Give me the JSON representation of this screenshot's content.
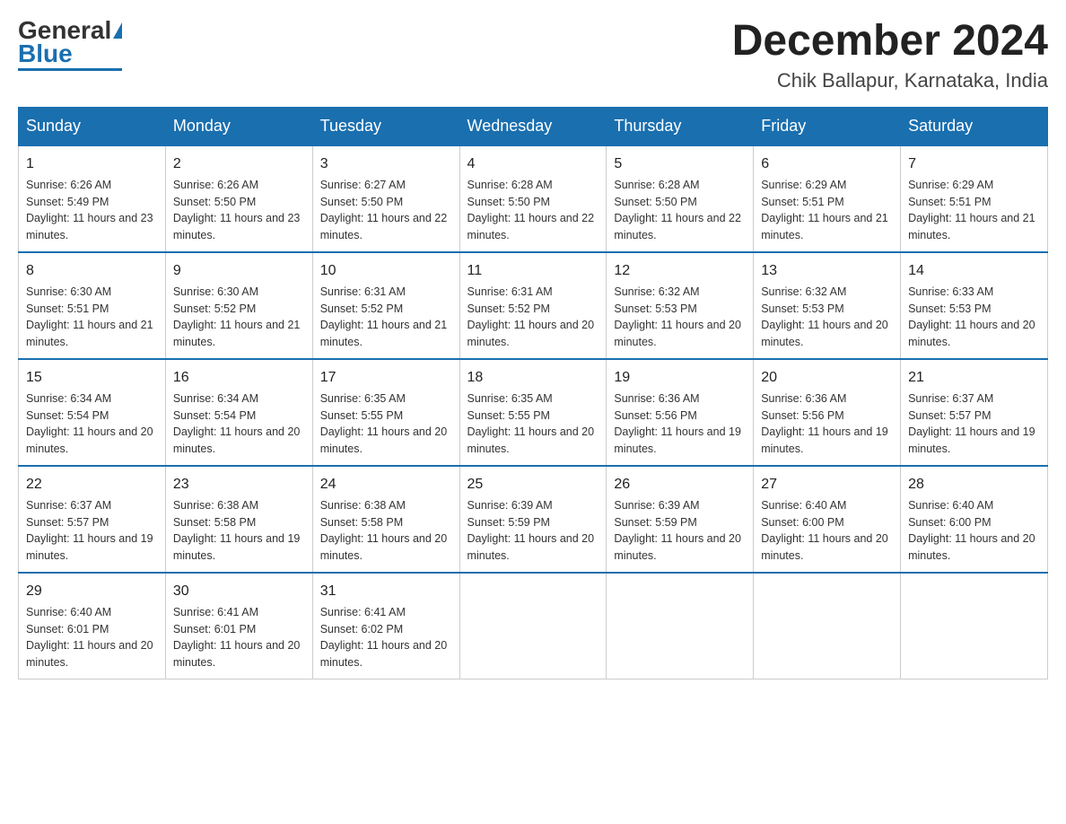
{
  "header": {
    "logo_general": "General",
    "logo_blue": "Blue",
    "month_title": "December 2024",
    "location": "Chik Ballapur, Karnataka, India"
  },
  "days_of_week": [
    "Sunday",
    "Monday",
    "Tuesday",
    "Wednesday",
    "Thursday",
    "Friday",
    "Saturday"
  ],
  "weeks": [
    [
      {
        "day": "1",
        "sunrise": "6:26 AM",
        "sunset": "5:49 PM",
        "daylight": "11 hours and 23 minutes."
      },
      {
        "day": "2",
        "sunrise": "6:26 AM",
        "sunset": "5:50 PM",
        "daylight": "11 hours and 23 minutes."
      },
      {
        "day": "3",
        "sunrise": "6:27 AM",
        "sunset": "5:50 PM",
        "daylight": "11 hours and 22 minutes."
      },
      {
        "day": "4",
        "sunrise": "6:28 AM",
        "sunset": "5:50 PM",
        "daylight": "11 hours and 22 minutes."
      },
      {
        "day": "5",
        "sunrise": "6:28 AM",
        "sunset": "5:50 PM",
        "daylight": "11 hours and 22 minutes."
      },
      {
        "day": "6",
        "sunrise": "6:29 AM",
        "sunset": "5:51 PM",
        "daylight": "11 hours and 21 minutes."
      },
      {
        "day": "7",
        "sunrise": "6:29 AM",
        "sunset": "5:51 PM",
        "daylight": "11 hours and 21 minutes."
      }
    ],
    [
      {
        "day": "8",
        "sunrise": "6:30 AM",
        "sunset": "5:51 PM",
        "daylight": "11 hours and 21 minutes."
      },
      {
        "day": "9",
        "sunrise": "6:30 AM",
        "sunset": "5:52 PM",
        "daylight": "11 hours and 21 minutes."
      },
      {
        "day": "10",
        "sunrise": "6:31 AM",
        "sunset": "5:52 PM",
        "daylight": "11 hours and 21 minutes."
      },
      {
        "day": "11",
        "sunrise": "6:31 AM",
        "sunset": "5:52 PM",
        "daylight": "11 hours and 20 minutes."
      },
      {
        "day": "12",
        "sunrise": "6:32 AM",
        "sunset": "5:53 PM",
        "daylight": "11 hours and 20 minutes."
      },
      {
        "day": "13",
        "sunrise": "6:32 AM",
        "sunset": "5:53 PM",
        "daylight": "11 hours and 20 minutes."
      },
      {
        "day": "14",
        "sunrise": "6:33 AM",
        "sunset": "5:53 PM",
        "daylight": "11 hours and 20 minutes."
      }
    ],
    [
      {
        "day": "15",
        "sunrise": "6:34 AM",
        "sunset": "5:54 PM",
        "daylight": "11 hours and 20 minutes."
      },
      {
        "day": "16",
        "sunrise": "6:34 AM",
        "sunset": "5:54 PM",
        "daylight": "11 hours and 20 minutes."
      },
      {
        "day": "17",
        "sunrise": "6:35 AM",
        "sunset": "5:55 PM",
        "daylight": "11 hours and 20 minutes."
      },
      {
        "day": "18",
        "sunrise": "6:35 AM",
        "sunset": "5:55 PM",
        "daylight": "11 hours and 20 minutes."
      },
      {
        "day": "19",
        "sunrise": "6:36 AM",
        "sunset": "5:56 PM",
        "daylight": "11 hours and 19 minutes."
      },
      {
        "day": "20",
        "sunrise": "6:36 AM",
        "sunset": "5:56 PM",
        "daylight": "11 hours and 19 minutes."
      },
      {
        "day": "21",
        "sunrise": "6:37 AM",
        "sunset": "5:57 PM",
        "daylight": "11 hours and 19 minutes."
      }
    ],
    [
      {
        "day": "22",
        "sunrise": "6:37 AM",
        "sunset": "5:57 PM",
        "daylight": "11 hours and 19 minutes."
      },
      {
        "day": "23",
        "sunrise": "6:38 AM",
        "sunset": "5:58 PM",
        "daylight": "11 hours and 19 minutes."
      },
      {
        "day": "24",
        "sunrise": "6:38 AM",
        "sunset": "5:58 PM",
        "daylight": "11 hours and 20 minutes."
      },
      {
        "day": "25",
        "sunrise": "6:39 AM",
        "sunset": "5:59 PM",
        "daylight": "11 hours and 20 minutes."
      },
      {
        "day": "26",
        "sunrise": "6:39 AM",
        "sunset": "5:59 PM",
        "daylight": "11 hours and 20 minutes."
      },
      {
        "day": "27",
        "sunrise": "6:40 AM",
        "sunset": "6:00 PM",
        "daylight": "11 hours and 20 minutes."
      },
      {
        "day": "28",
        "sunrise": "6:40 AM",
        "sunset": "6:00 PM",
        "daylight": "11 hours and 20 minutes."
      }
    ],
    [
      {
        "day": "29",
        "sunrise": "6:40 AM",
        "sunset": "6:01 PM",
        "daylight": "11 hours and 20 minutes."
      },
      {
        "day": "30",
        "sunrise": "6:41 AM",
        "sunset": "6:01 PM",
        "daylight": "11 hours and 20 minutes."
      },
      {
        "day": "31",
        "sunrise": "6:41 AM",
        "sunset": "6:02 PM",
        "daylight": "11 hours and 20 minutes."
      },
      null,
      null,
      null,
      null
    ]
  ]
}
